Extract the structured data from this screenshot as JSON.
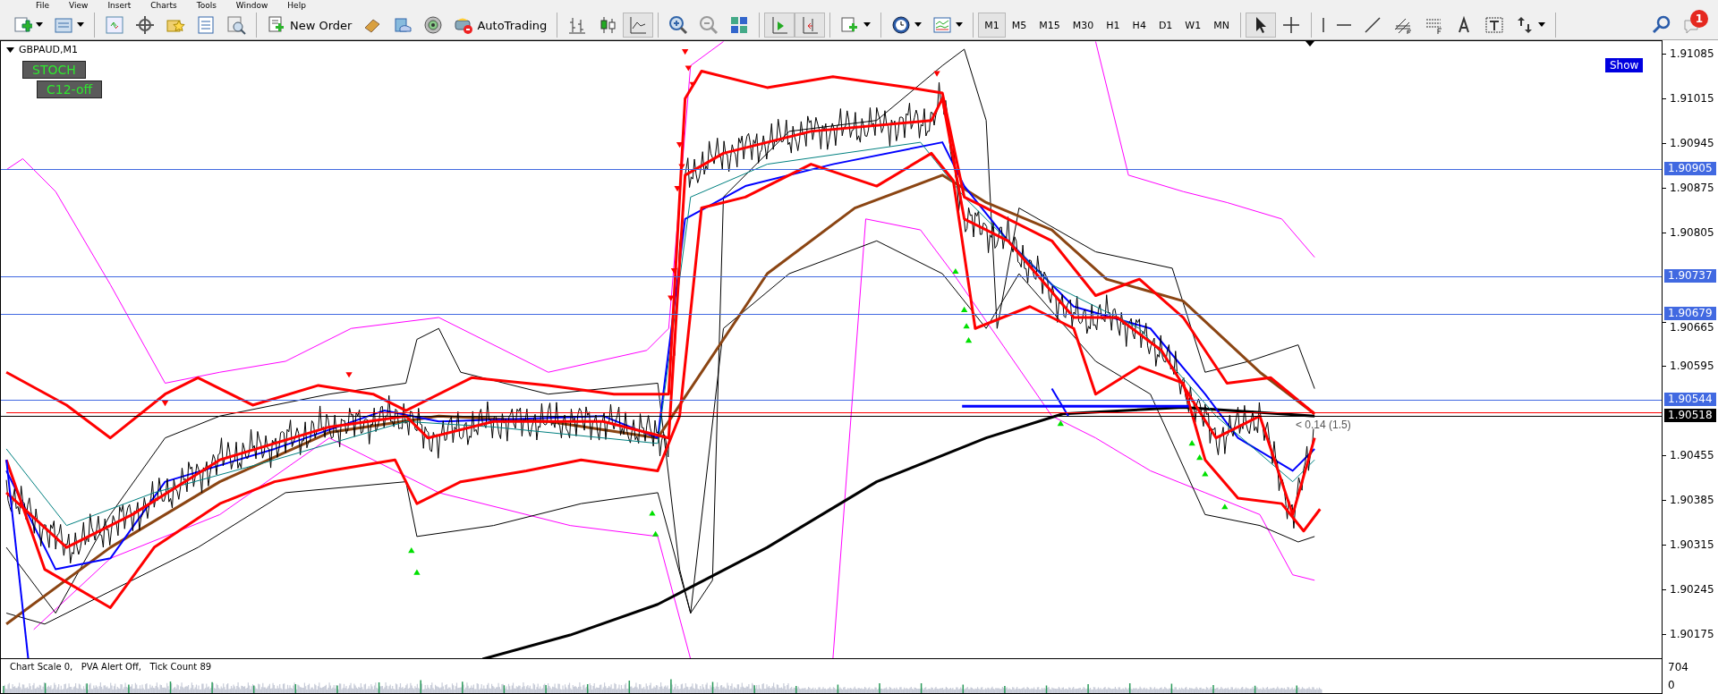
{
  "menu": [
    "File",
    "View",
    "Insert",
    "Charts",
    "Tools",
    "Window",
    "Help"
  ],
  "toolbar": {
    "new_order": "New Order",
    "auto_trading": "AutoTrading",
    "timeframes": [
      {
        "label": "M1",
        "selected": true
      },
      {
        "label": "M5",
        "selected": false
      },
      {
        "label": "M15",
        "selected": false
      },
      {
        "label": "M30",
        "selected": false
      },
      {
        "label": "H1",
        "selected": false
      },
      {
        "label": "H4",
        "selected": false
      },
      {
        "label": "D1",
        "selected": false
      },
      {
        "label": "W1",
        "selected": false
      },
      {
        "label": "MN",
        "selected": false
      }
    ],
    "notifications": "1"
  },
  "chart": {
    "symbol": "GBPAUD,M1",
    "panel_labels": [
      "STOCH",
      "C12-off"
    ],
    "show_button": "Show",
    "annotation": "< 0.14 (1.5)",
    "price_ticks": [
      "1.91085",
      "1.91015",
      "1.90945",
      "1.90875",
      "1.90805",
      "1.90665",
      "1.90595",
      "1.90455",
      "1.90385",
      "1.90315",
      "1.90245",
      "1.90175"
    ],
    "levels": [
      {
        "label": "1.90905",
        "color": "#4169e1"
      },
      {
        "label": "1.90737",
        "color": "#4169e1"
      },
      {
        "label": "1.90679",
        "color": "#4169e1"
      },
      {
        "label": "1.90544",
        "color": "#4169e1"
      },
      {
        "label": "1.90518",
        "color": "#000000"
      }
    ]
  },
  "indicator": {
    "status": "Chart Scale 0,   PVA Alert Off,   Tick Count 89",
    "scale_max": "704",
    "scale_min": "0"
  }
}
